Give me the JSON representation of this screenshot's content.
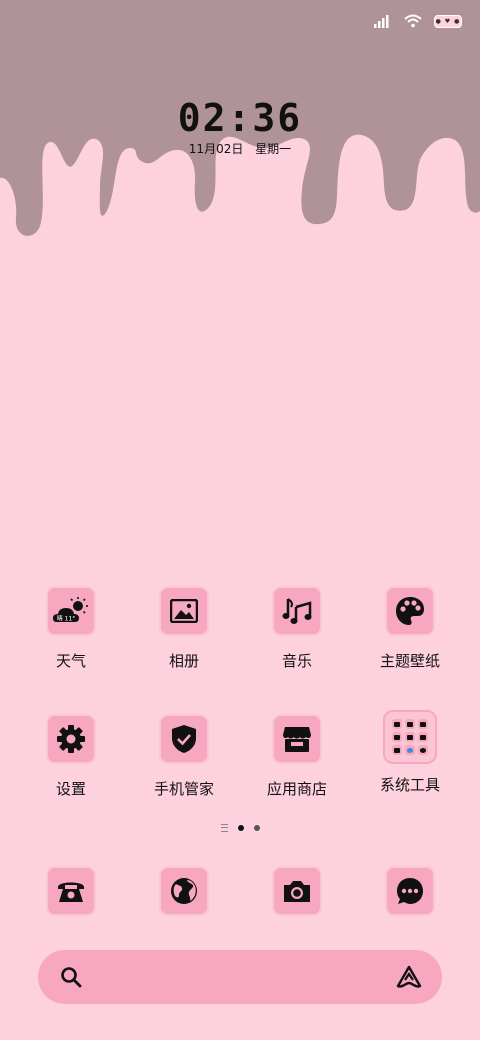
{
  "status_bar": {
    "signal_icon": "signal-icon",
    "wifi_icon": "wifi-icon",
    "battery_icon": "battery-icon"
  },
  "lock": {
    "time": "02:36",
    "date": "11月02日",
    "weekday": "星期一"
  },
  "apps_row1": [
    {
      "label": "天气",
      "icon": "weather-icon",
      "weather_text": "晴 11°"
    },
    {
      "label": "相册",
      "icon": "gallery-icon"
    },
    {
      "label": "音乐",
      "icon": "music-icon"
    },
    {
      "label": "主题壁纸",
      "icon": "palette-icon"
    }
  ],
  "apps_row2": [
    {
      "label": "设置",
      "icon": "gear-icon"
    },
    {
      "label": "手机管家",
      "icon": "shield-icon"
    },
    {
      "label": "应用商店",
      "icon": "store-icon"
    },
    {
      "label": "系统工具",
      "icon": "folder-icon"
    }
  ],
  "dock": [
    {
      "icon": "phone-icon"
    },
    {
      "icon": "browser-icon"
    },
    {
      "icon": "camera-icon"
    },
    {
      "icon": "messages-icon"
    }
  ],
  "search_bar": {
    "search_icon": "search-icon",
    "assistant_icon": "assistant-icon"
  },
  "colors": {
    "background": "#fdd2de",
    "drip": "#b09399",
    "tile": "#f7a7bf"
  }
}
